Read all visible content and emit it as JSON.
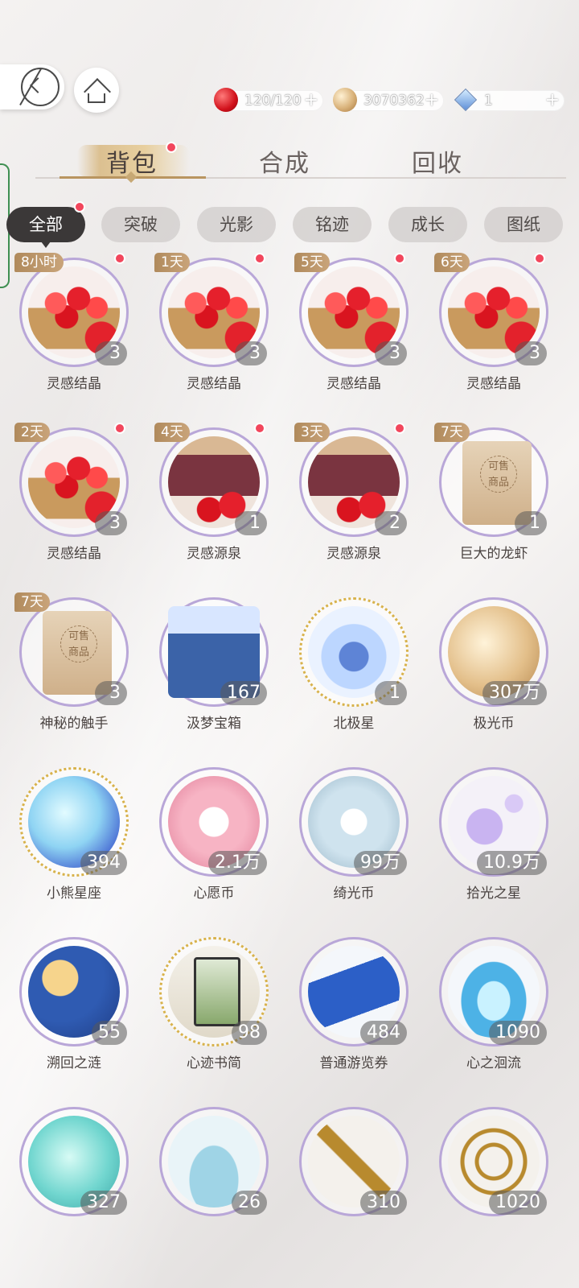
{
  "header": {
    "currencies": [
      {
        "icon": "apple-icon",
        "value": "120/120",
        "plus": "+"
      },
      {
        "icon": "coin-icon",
        "value": "3070362",
        "plus": "+"
      },
      {
        "icon": "gem-icon",
        "value": "1",
        "plus": "+"
      }
    ]
  },
  "main_tabs": [
    {
      "label": "背包",
      "active": true
    },
    {
      "label": "合成",
      "active": false
    },
    {
      "label": "回收",
      "active": false
    }
  ],
  "filter_chips": [
    "全部",
    "突破",
    "光影",
    "铭迹",
    "成长",
    "图纸"
  ],
  "items": [
    {
      "name": "灵感结晶",
      "count": "3",
      "timer": "8小时",
      "icon": "apple-basket-icon",
      "new": true
    },
    {
      "name": "灵感结晶",
      "count": "3",
      "timer": "1天",
      "icon": "apple-basket-icon",
      "new": true
    },
    {
      "name": "灵感结晶",
      "count": "3",
      "timer": "5天",
      "icon": "apple-basket-icon",
      "new": true
    },
    {
      "name": "灵感结晶",
      "count": "3",
      "timer": "6天",
      "icon": "apple-basket-icon",
      "new": true
    },
    {
      "name": "灵感结晶",
      "count": "3",
      "timer": "2天",
      "icon": "apple-basket-icon",
      "new": true
    },
    {
      "name": "灵感源泉",
      "count": "1",
      "timer": "4天",
      "icon": "apple-box-icon",
      "new": true
    },
    {
      "name": "灵感源泉",
      "count": "2",
      "timer": "3天",
      "icon": "apple-box-icon",
      "new": true
    },
    {
      "name": "巨大的龙虾",
      "count": "1",
      "timer": "7天",
      "icon": "sellable-paper-icon",
      "new": false
    },
    {
      "name": "神秘的触手",
      "count": "3",
      "timer": "7天",
      "icon": "sellable-paper-icon",
      "new": false
    },
    {
      "name": "汲梦宝箱",
      "count": "167",
      "timer": "",
      "icon": "chest-icon",
      "new": false
    },
    {
      "name": "北极星",
      "count": "1",
      "timer": "",
      "icon": "crystal-icon",
      "new": false
    },
    {
      "name": "极光币",
      "count": "307万",
      "timer": "",
      "icon": "gold-coin-icon",
      "new": false
    },
    {
      "name": "小熊星座",
      "count": "394",
      "timer": "",
      "icon": "constellation-coin-icon",
      "new": false
    },
    {
      "name": "心愿币",
      "count": "2.1万",
      "timer": "",
      "icon": "flower-coin-icon",
      "new": false
    },
    {
      "name": "绮光币",
      "count": "99万",
      "timer": "",
      "icon": "silver-coin-icon",
      "new": false
    },
    {
      "name": "拾光之星",
      "count": "10.9万",
      "timer": "",
      "icon": "sparkle-icon",
      "new": false
    },
    {
      "name": "溯回之涟",
      "count": "55",
      "timer": "",
      "icon": "sun-moon-icon",
      "new": false
    },
    {
      "name": "心迹书简",
      "count": "98",
      "timer": "",
      "icon": "card-icon",
      "new": false
    },
    {
      "name": "普通游览券",
      "count": "484",
      "timer": "",
      "icon": "ticket-icon",
      "new": false
    },
    {
      "name": "心之洄流",
      "count": "1090",
      "timer": "",
      "icon": "water-drop-icon",
      "new": false
    },
    {
      "name": "",
      "count": "327",
      "timer": "",
      "icon": "teal-coin-icon",
      "new": false
    },
    {
      "name": "",
      "count": "26",
      "timer": "",
      "icon": "moon-bottle-icon",
      "new": false
    },
    {
      "name": "",
      "count": "310",
      "timer": "",
      "icon": "golden-key-icon",
      "new": false
    },
    {
      "name": "",
      "count": "1020",
      "timer": "",
      "icon": "astrolabe-icon",
      "new": false
    }
  ]
}
